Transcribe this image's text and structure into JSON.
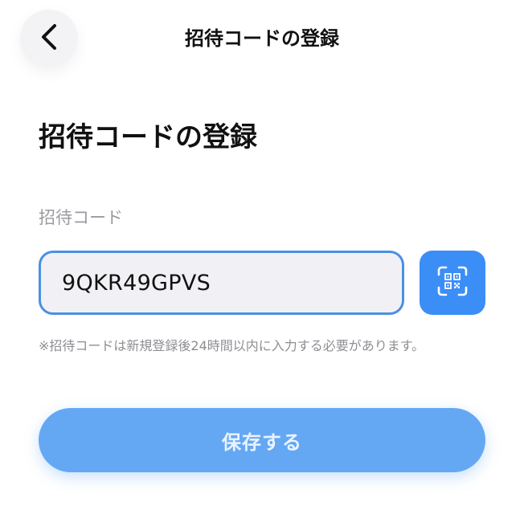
{
  "header": {
    "title": "招待コードの登録",
    "back_icon": "chevron-left-icon"
  },
  "main": {
    "title": "招待コードの登録",
    "field_label": "招待コード",
    "code_value": "9QKR49GPVS",
    "qr_icon": "qr-scan-icon",
    "note": "※招待コードは新規登録後24時間以内に入力する必要があります。",
    "save_label": "保存する"
  },
  "colors": {
    "accent": "#3a8ef6",
    "save_button": "#64a8f4",
    "input_border": "#4a90e2",
    "input_bg": "#f1f1f5",
    "muted_text": "#8e8e93"
  }
}
